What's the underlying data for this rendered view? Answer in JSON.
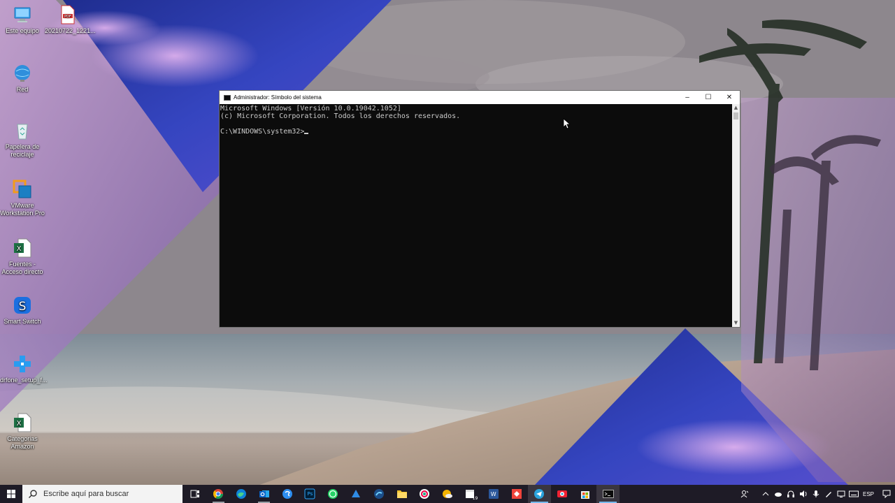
{
  "desktop": {
    "icons": [
      {
        "label": "Este equipo",
        "icon": "computer-icon"
      },
      {
        "label": "20210722_1221...",
        "icon": "pdf-file-icon"
      },
      {
        "label": "Red",
        "icon": "network-icon"
      },
      {
        "label": "Papelera de reciclaje",
        "icon": "recycle-bin-icon"
      },
      {
        "label": "VMware Workstation Pro",
        "icon": "vmware-icon"
      },
      {
        "label": "Fuentes - Acceso directo",
        "icon": "excel-file-icon"
      },
      {
        "label": "Smart Switch",
        "icon": "smart-switch-icon"
      },
      {
        "label": "drfone_setup_f...",
        "icon": "drfone-setup-icon"
      },
      {
        "label": "Categorias Amazon",
        "icon": "excel-file-icon"
      }
    ]
  },
  "cmd_window": {
    "title": "Administrador: Símbolo del sistema",
    "lines": [
      "Microsoft Windows [Versión 10.0.19042.1052]",
      "(c) Microsoft Corporation. Todos los derechos reservados.",
      "",
      "C:\\WINDOWS\\system32>"
    ],
    "controls": {
      "minimize": "–",
      "maximize": "☐",
      "close": "✕"
    }
  },
  "taskbar": {
    "search_placeholder": "Escribe aquí para buscar",
    "apps": [
      {
        "name": "task-view-icon"
      },
      {
        "name": "chrome-icon"
      },
      {
        "name": "edge-icon"
      },
      {
        "name": "outlook-icon"
      },
      {
        "name": "skype-icon"
      },
      {
        "name": "photoshop-icon",
        "text": "Ps"
      },
      {
        "name": "whatsapp-icon"
      },
      {
        "name": "vpn-icon"
      },
      {
        "name": "edge-dev-icon"
      },
      {
        "name": "file-explorer-icon"
      },
      {
        "name": "camera-app-icon"
      },
      {
        "name": "weather-icon"
      },
      {
        "name": "calendar-icon",
        "text": "19"
      },
      {
        "name": "word-icon",
        "text": "W"
      },
      {
        "name": "anydesk-icon"
      },
      {
        "name": "telegram-icon"
      },
      {
        "name": "photo-app-icon"
      },
      {
        "name": "store-icon"
      },
      {
        "name": "cmd-icon"
      }
    ],
    "tray": {
      "language": "ESP"
    },
    "colors": {
      "active_underline": "#76b9ed",
      "bar": "#1e1b26"
    }
  }
}
